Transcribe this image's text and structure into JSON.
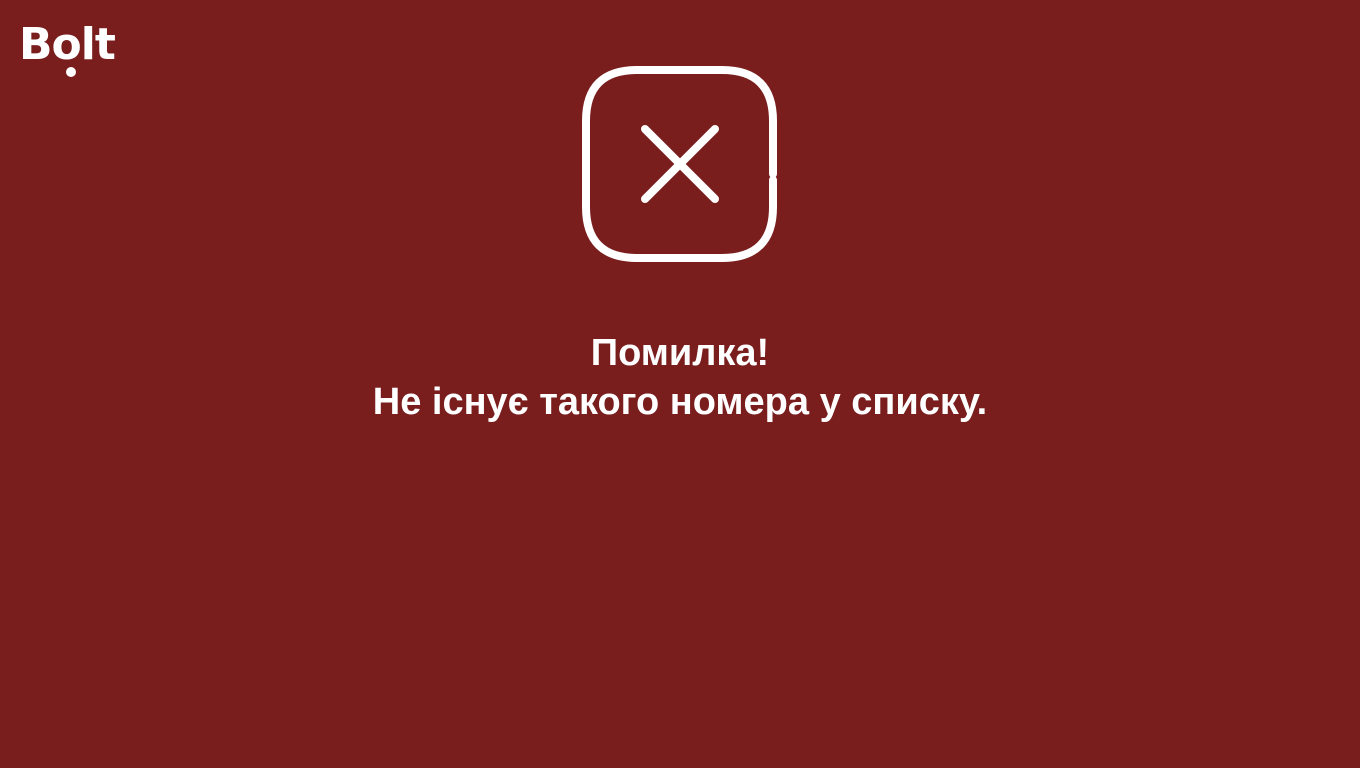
{
  "brand": {
    "name": "Bolt"
  },
  "error": {
    "title": "Помилка!",
    "message": "Не існує такого номера у списку.",
    "icon": "close-box-icon"
  },
  "colors": {
    "background": "#791d1d",
    "foreground": "#ffffff"
  }
}
